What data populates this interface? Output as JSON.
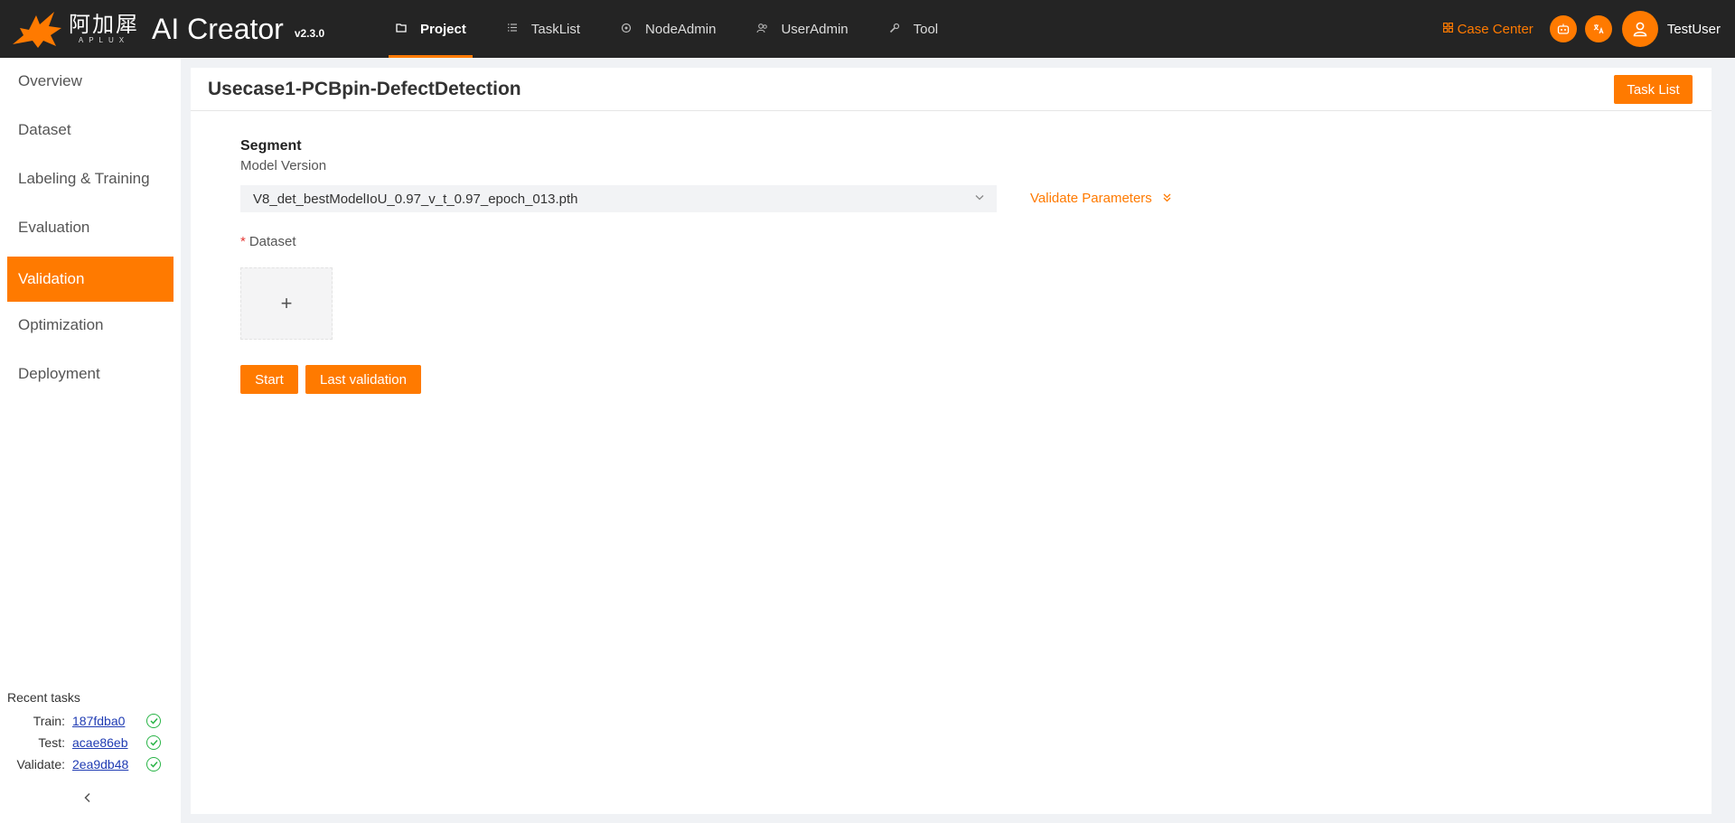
{
  "brand": {
    "cn_name": "阿加犀",
    "cn_sub": "APLUX",
    "title": "AI Creator",
    "version": "v2.3.0",
    "accent_color": "#ff7a00"
  },
  "nav": {
    "items": [
      {
        "label": "Project",
        "icon": "folder-icon",
        "active": true
      },
      {
        "label": "TaskList",
        "icon": "list-icon",
        "active": false
      },
      {
        "label": "NodeAdmin",
        "icon": "node-icon",
        "active": false
      },
      {
        "label": "UserAdmin",
        "icon": "users-icon",
        "active": false
      },
      {
        "label": "Tool",
        "icon": "wrench-icon",
        "active": false
      }
    ]
  },
  "header_right": {
    "case_center": "Case Center",
    "username": "TestUser"
  },
  "sidebar": {
    "items": [
      {
        "label": "Overview"
      },
      {
        "label": "Dataset"
      },
      {
        "label": "Labeling & Training"
      },
      {
        "label": "Evaluation"
      },
      {
        "label": "Validation",
        "active": true
      },
      {
        "label": "Optimization"
      },
      {
        "label": "Deployment"
      }
    ],
    "recent": {
      "title": "Recent tasks",
      "rows": [
        {
          "label": "Train:",
          "id": "187fdba0"
        },
        {
          "label": "Test:",
          "id": "acae86eb"
        },
        {
          "label": "Validate:",
          "id": "2ea9db48"
        }
      ]
    }
  },
  "main": {
    "title": "Usecase1-PCBpin-DefectDetection",
    "task_list_button": "Task List",
    "section_title": "Segment",
    "model_version_label": "Model Version",
    "model_version_value": "V8_det_bestModelIoU_0.97_v_t_0.97_epoch_013.pth",
    "validate_parameters": "Validate Parameters",
    "dataset_required": "*",
    "dataset_label": "Dataset",
    "upload_plus": "+",
    "start_button": "Start",
    "last_validation_button": "Last validation"
  }
}
